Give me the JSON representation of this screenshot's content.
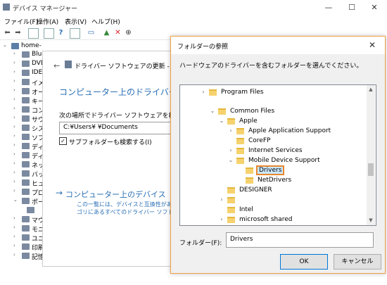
{
  "device_manager": {
    "title": "デバイス マネージャー",
    "menu": [
      "ファイル(F)",
      "操作(A)",
      "表示(V)",
      "ヘルプ(H)"
    ],
    "tree_root": "home-",
    "tree_items": [
      "Blue",
      "DVD",
      "IDE",
      "イメ",
      "オー",
      "キー",
      "コン",
      "サウ",
      "シス",
      "ソフ",
      "ディ",
      "ディ",
      "ネッ",
      "バッ",
      "ヒュ",
      "プロ",
      "ポー",
      "",
      "マウ",
      "モニ",
      "ユニ",
      "印刷",
      "記憶"
    ]
  },
  "driver_wizard": {
    "title": "ドライバー ソフトウェアの更新 - Apple iPhone",
    "heading": "コンピューター上のドライバー ソフトウェ",
    "search_label": "次の場所でドライバー ソフトウェアを検索します:",
    "path_value": "C:¥Users¥      ¥Documents",
    "include_subfolders_label": "サブフォルダーも検索する(I)",
    "include_subfolders_checked": true,
    "link_text": "コンピューター上のデバイス ドライ",
    "link_desc_1": "この一覧には、デバイスと互換性があるイ",
    "link_desc_2": "ゴリにあるすべてのドライバー ソフトウェアが"
  },
  "folder_dialog": {
    "title": "フォルダーの参照",
    "instruction": "ハードウェアのドライバーを含むフォルダーを選んでください。",
    "tree": [
      {
        "label": "Program Files",
        "expander": "›",
        "selected": false
      },
      {
        "label": "Common Files",
        "expander": "⌄",
        "selected": false
      },
      {
        "label": "Apple",
        "expander": "⌄",
        "selected": false
      },
      {
        "label": "Apple Application Support",
        "expander": "›",
        "selected": false
      },
      {
        "label": "CoreFP",
        "expander": "",
        "selected": false
      },
      {
        "label": "Internet Services",
        "expander": "›",
        "selected": false
      },
      {
        "label": "Mobile Device Support",
        "expander": "⌄",
        "selected": false
      },
      {
        "label": "Drivers",
        "expander": "",
        "selected": true
      },
      {
        "label": "NetDrivers",
        "expander": "",
        "selected": false
      },
      {
        "label": "DESIGNER",
        "expander": "",
        "selected": false
      },
      {
        "label": "",
        "expander": "›",
        "selected": false
      },
      {
        "label": "Intel",
        "expander": "",
        "selected": false
      },
      {
        "label": "microsoft shared",
        "expander": "›",
        "selected": false
      }
    ],
    "folder_label": "フォルダー(F):",
    "folder_value": "Drivers",
    "ok_label": "OK",
    "cancel_label": "キャンセル"
  }
}
